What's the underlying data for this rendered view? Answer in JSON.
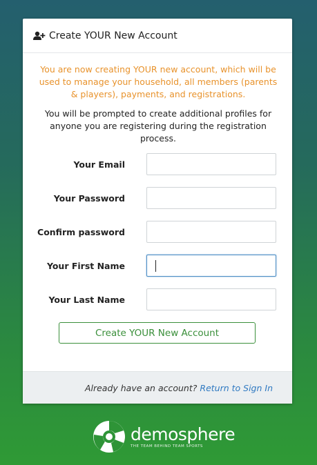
{
  "card": {
    "header_title": "Create YOUR New Account",
    "header_icon": "user-plus-icon",
    "intro_warning": "You are now creating YOUR new account, which will be used to manage your household, all members (parents & players), payments, and registrations.",
    "intro_info": "You will be prompted to create additional profiles for anyone you are registering during the registration process."
  },
  "form": {
    "fields": [
      {
        "label": "Your Email",
        "value": ""
      },
      {
        "label": "Your Password",
        "value": ""
      },
      {
        "label": "Confirm password",
        "value": ""
      },
      {
        "label": "Your First Name",
        "value": ""
      },
      {
        "label": "Your Last Name",
        "value": ""
      }
    ],
    "submit_label": "Create YOUR New Account"
  },
  "footer": {
    "question": "Already have an account?",
    "link_label": "Return to Sign In"
  },
  "brand": {
    "name": "demosphere",
    "tagline": "THE TEAM BEHIND TEAM SPORTS",
    "logo_icon": "demosphere-logo-icon"
  },
  "colors": {
    "warning": "#e8922b",
    "primary_green": "#3a8f3a",
    "link": "#2f79c1",
    "focus": "#4a8cc4"
  }
}
